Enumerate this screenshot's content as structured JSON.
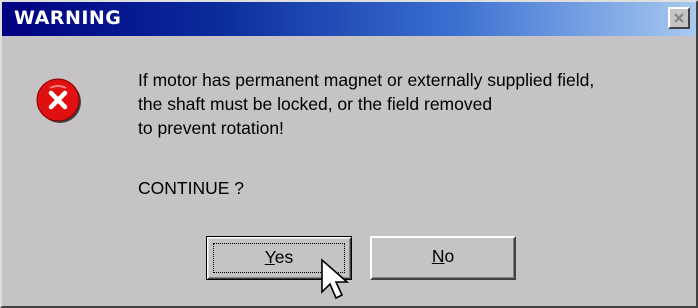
{
  "window": {
    "title": "WARNING"
  },
  "icons": {
    "error": "error-circle-icon",
    "close": "close-icon",
    "cursor": "mouse-pointer-icon"
  },
  "message": {
    "lines": [
      "If motor has permanent magnet or externally supplied field,",
      "the shaft must be locked, or the field removed",
      "to prevent rotation!"
    ],
    "prompt": "CONTINUE ?"
  },
  "buttons": {
    "yes": {
      "mnemonic": "Y",
      "rest": "es"
    },
    "no": {
      "mnemonic": "N",
      "rest": "o"
    }
  },
  "colors": {
    "titlebar_start": "#000080",
    "titlebar_end": "#a8caf0",
    "dialog_face": "#c6c3c6",
    "error_red": "#e01010"
  }
}
